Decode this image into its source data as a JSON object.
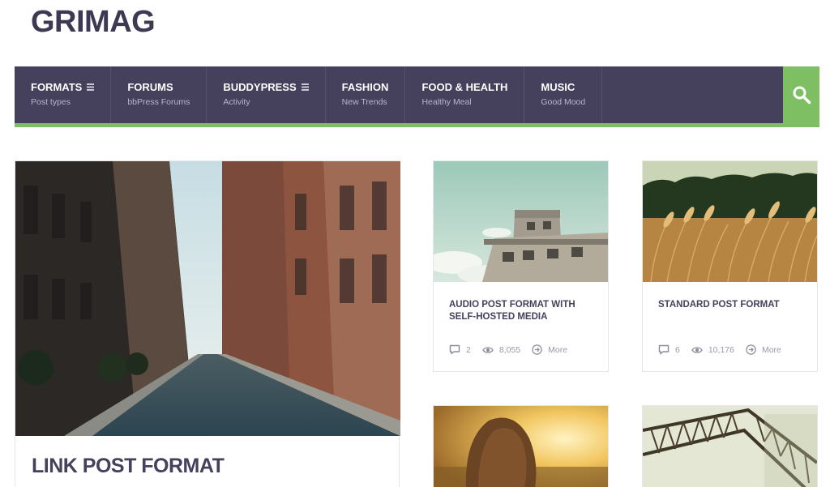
{
  "site": {
    "logo": "GRIMAG"
  },
  "nav": {
    "items": [
      {
        "title": "FORMATS",
        "sub": "Post types",
        "has_menu": true
      },
      {
        "title": "FORUMS",
        "sub": "bbPress Forums",
        "has_menu": false
      },
      {
        "title": "BUDDYPRESS",
        "sub": "Activity",
        "has_menu": true
      },
      {
        "title": "FASHION",
        "sub": "New Trends",
        "has_menu": false
      },
      {
        "title": "FOOD & HEALTH",
        "sub": "Healthy Meal",
        "has_menu": false
      },
      {
        "title": "MUSIC",
        "sub": "Good Mood",
        "has_menu": false
      }
    ],
    "search_icon": "search-icon"
  },
  "featured": {
    "title": "LINK POST FORMAT"
  },
  "posts": [
    {
      "title": "AUDIO POST FORMAT WITH SELF-HOSTED MEDIA",
      "comments": "2",
      "views": "8,055",
      "more": "More"
    },
    {
      "title": "STANDARD POST FORMAT",
      "comments": "6",
      "views": "10,176",
      "more": "More"
    }
  ],
  "colors": {
    "nav_bg": "#45405c",
    "accent_green": "#7fbf63",
    "title_text": "#45405c"
  }
}
